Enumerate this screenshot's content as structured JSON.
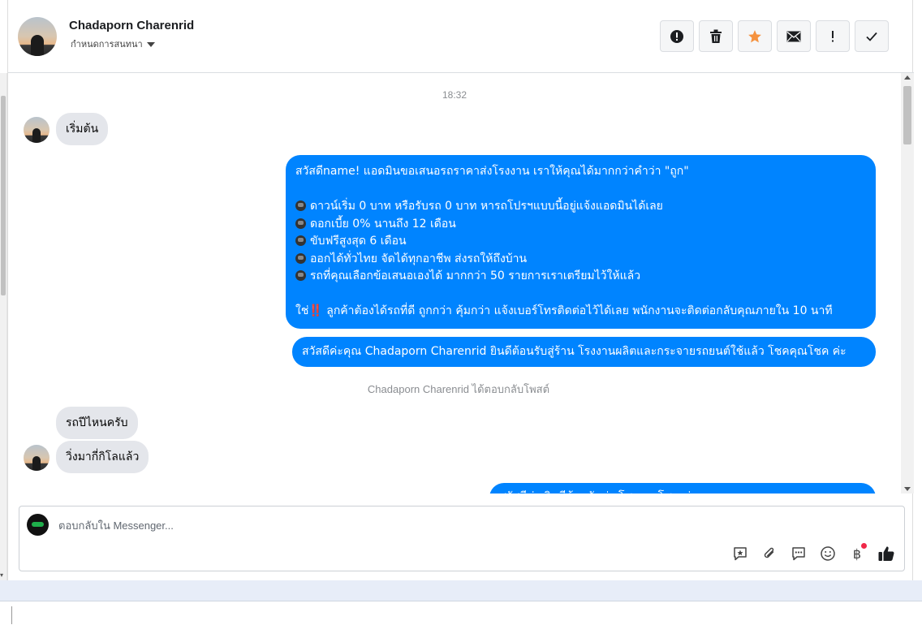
{
  "header": {
    "contact_name": "Chadaporn Charenrid",
    "subtitle": "กำหนดการสนทนา",
    "actions": [
      {
        "name": "report-icon",
        "label": "report"
      },
      {
        "name": "trash-icon",
        "label": "delete"
      },
      {
        "name": "star-icon",
        "label": "star"
      },
      {
        "name": "mail-icon",
        "label": "mark unread"
      },
      {
        "name": "exclamation-icon",
        "label": "important"
      },
      {
        "name": "check-icon",
        "label": "done"
      }
    ],
    "star_color": "#f5923e"
  },
  "chat": {
    "timestamp": "18:32",
    "messages": {
      "m1": "เริ่มต้น",
      "m2_lines": [
        "สวัสดีname! แอดมินขอเสนอรถราคาส่งโรงงาน เราให้คุณได้มากกว่าคำว่า \"ถูก\"",
        "",
        "ดาวน์เริ่ม 0 บาท หรือรับรถ 0 บาท หารถโปรฯแบบนี้อยู่แจ้งแอดมินได้เลย",
        "ดอกเบี้ย 0% นานถึง 12 เดือน",
        "ขับฟรีสูงสุด 6 เดือน",
        "ออกได้ทั่วไทย จัดได้ทุกอาชีพ ส่งรถให้ถึงบ้าน",
        "รถที่คุณเลือกข้อเสนอเองได้ มากกว่า 50 รายการเราเตรียมไว้ให้แล้ว",
        "",
        "ลูกค้าต้องได้รถที่ดี ถูกกว่า คุ้มกว่า แจ้งเบอร์โทรติดต่อไว้ได้เลย พนักงานจะติดต่อกลับคุณภายใน 10 นาที"
      ],
      "m2_last_prefix": "ใช่",
      "m2_last_mark": "‼️",
      "m3": "สวัสดีค่ะคุณ Chadaporn Charenrid ยินดีต้อนรับสู่ร้าน โรงงานผลิตและกระจายรถยนต์ใช้แล้ว โชคคุณโชค ค่ะ",
      "reply_note": "Chadaporn Charenrid ได้ตอบกลับโพสต์",
      "m4": "รถปีไหนครับ",
      "m5": "วิ่งมากี่กิโลแล้ว",
      "m6": "สวัสดีค่ะ ยินดีต้อนรับค่ะ โชคคุณโชค ค่ะ"
    },
    "bubble_out_color": "#0084ff",
    "bubble_in_color": "#e4e6eb"
  },
  "composer": {
    "placeholder": "ตอบกลับใน Messenger...",
    "tools": [
      "saved-reply-icon",
      "attachment-icon",
      "quick-reply-icon",
      "emoji-icon",
      "baht-icon",
      "like-icon"
    ],
    "baht_symbol": "฿"
  }
}
